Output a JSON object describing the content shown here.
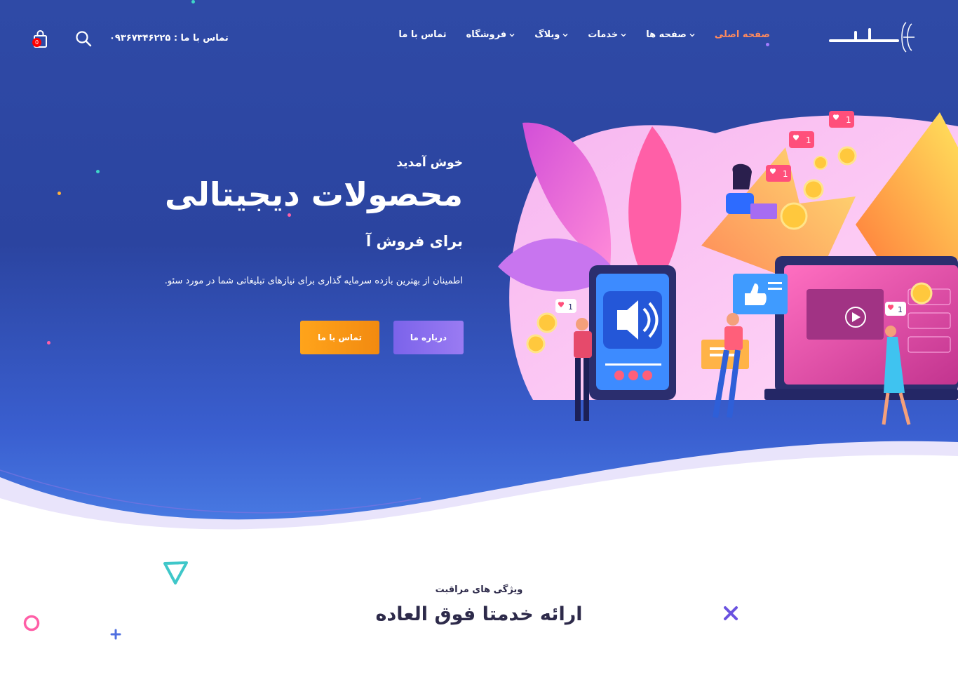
{
  "brand": {
    "logo_text": "کـــاف",
    "accent": "#ff8a5c",
    "hero_top": "#2f4aa6",
    "hero_bottom": "#4b7fe6"
  },
  "nav": {
    "items": [
      {
        "label": "صفحه اصلی",
        "active": true,
        "dropdown": false
      },
      {
        "label": "صفحه ها",
        "active": false,
        "dropdown": true
      },
      {
        "label": "خدمات",
        "active": false,
        "dropdown": true
      },
      {
        "label": "وبلاگ",
        "active": false,
        "dropdown": true
      },
      {
        "label": "فروشگاه",
        "active": false,
        "dropdown": true
      },
      {
        "label": "تماس با ما",
        "active": false,
        "dropdown": false
      }
    ]
  },
  "header": {
    "contact_label": "تماس با ما :",
    "contact_phone": "۰۹۳۶۷۳۴۶۲۲۵",
    "search_icon": "search-icon",
    "cart_icon": "shopping-bag-icon",
    "cart_count": "0"
  },
  "hero": {
    "welcome": "خوش آمدید",
    "headline": "محصولات دیجیتالی",
    "subheadline": "برای فروش آ",
    "description": "اطمینان از بهترین بازده سرمایه گذاری برای نیازهای تبلیغاتی شما در مورد سئو.",
    "about_button": "درباره ما",
    "contact_button": "تماس با ما",
    "like_badge": "1",
    "about_button_color": "#8a70ef",
    "contact_button_color": "#f7981a"
  },
  "features": {
    "subtitle": "ویژگی های مراقبت",
    "title": "ارائه خدمتا فوق العاده"
  }
}
